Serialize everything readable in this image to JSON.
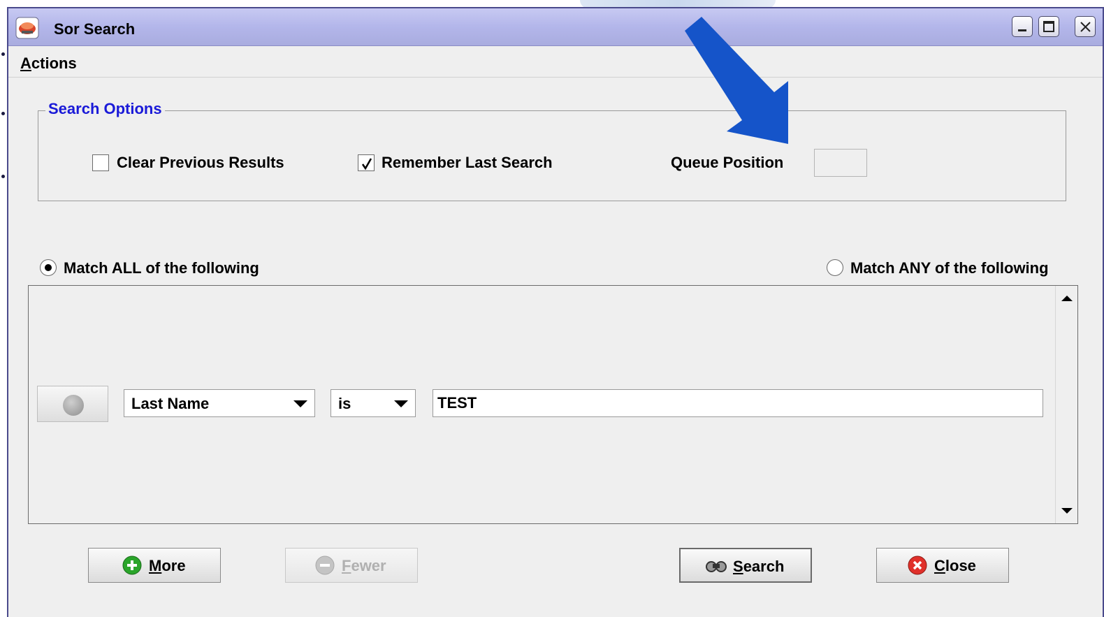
{
  "window": {
    "title": "Sor Search",
    "accent_color": "#1a1ad8",
    "titlebar_color": "#b3b6ea"
  },
  "menu": {
    "items": [
      {
        "label": "Actions",
        "mnemonic": "A"
      }
    ]
  },
  "search_options": {
    "group_title": "Search Options",
    "clear_previous_results": {
      "label": "Clear Previous Results",
      "checked": false
    },
    "remember_last_search": {
      "label": "Remember Last Search",
      "checked": true
    },
    "queue_position": {
      "label": "Queue Position",
      "value": ""
    }
  },
  "match_mode": {
    "all_label": "Match ALL of the following",
    "any_label": "Match ANY of the following",
    "selected": "all"
  },
  "criteria": [
    {
      "field": "Last Name",
      "operator": "is",
      "value": "TEST"
    }
  ],
  "buttons": {
    "more": {
      "label_mnemonic": "M",
      "label_rest": "ore",
      "icon": "plus-icon"
    },
    "fewer": {
      "label_mnemonic": "F",
      "label_rest": "ewer",
      "icon": "minus-icon",
      "enabled": false
    },
    "search": {
      "label_mnemonic": "S",
      "label_rest": "earch",
      "icon": "binoculars-icon"
    },
    "close": {
      "label_mnemonic": "C",
      "label_rest": "lose",
      "icon": "close-icon"
    }
  },
  "annotation": {
    "arrow_color": "#1554c9"
  }
}
